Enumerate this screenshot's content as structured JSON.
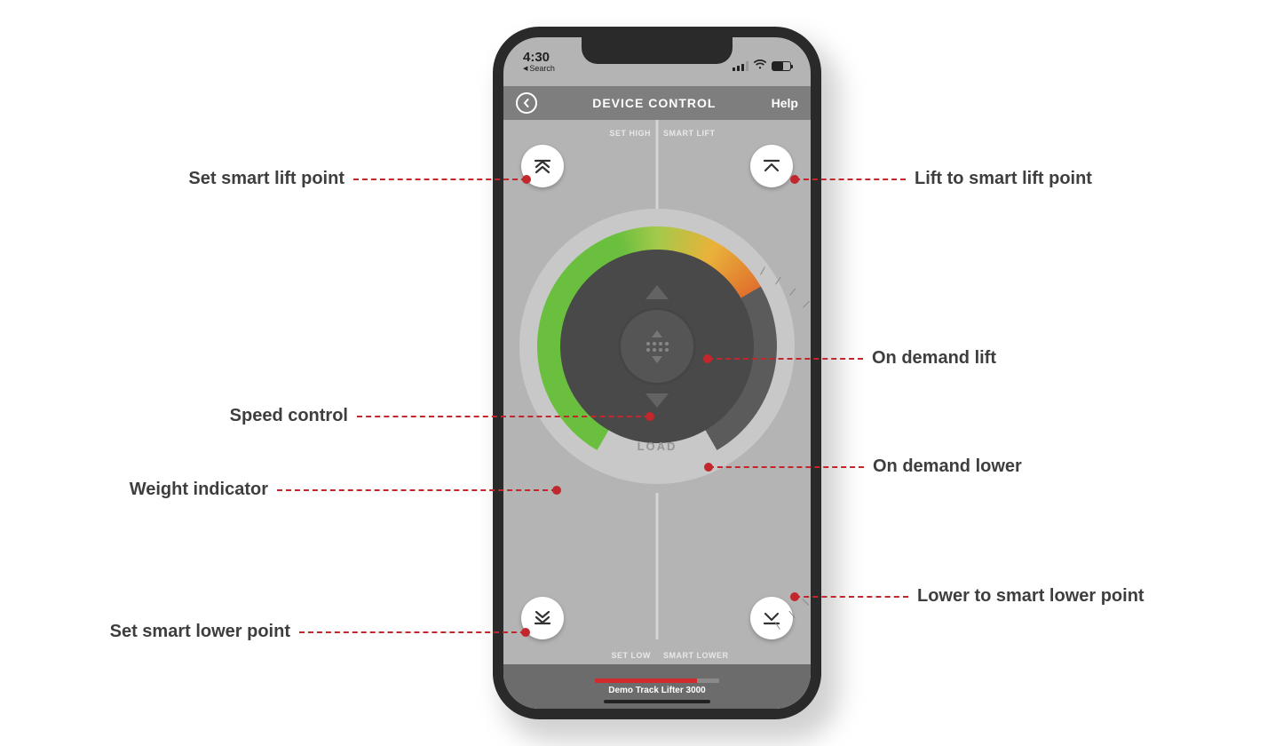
{
  "status": {
    "time": "4:30",
    "back_label": "Search"
  },
  "nav": {
    "title": "DEVICE CONTROL",
    "help": "Help"
  },
  "labels": {
    "set_high": "SET HIGH",
    "smart_lift": "SMART LIFT",
    "set_low": "SET LOW",
    "smart_lower": "SMART LOWER",
    "load": "LOAD"
  },
  "footer": {
    "device_name": "Demo Track Lifter 3000"
  },
  "callouts": {
    "set_lift_point": "Set smart lift point",
    "speed_control": "Speed control",
    "weight_indicator": "Weight indicator",
    "set_lower_point": "Set smart lower point",
    "lift_to_point": "Lift to smart lift point",
    "on_demand_lift": "On demand lift",
    "on_demand_lower": "On demand lower",
    "lower_to_point": "Lower to smart lower point"
  }
}
